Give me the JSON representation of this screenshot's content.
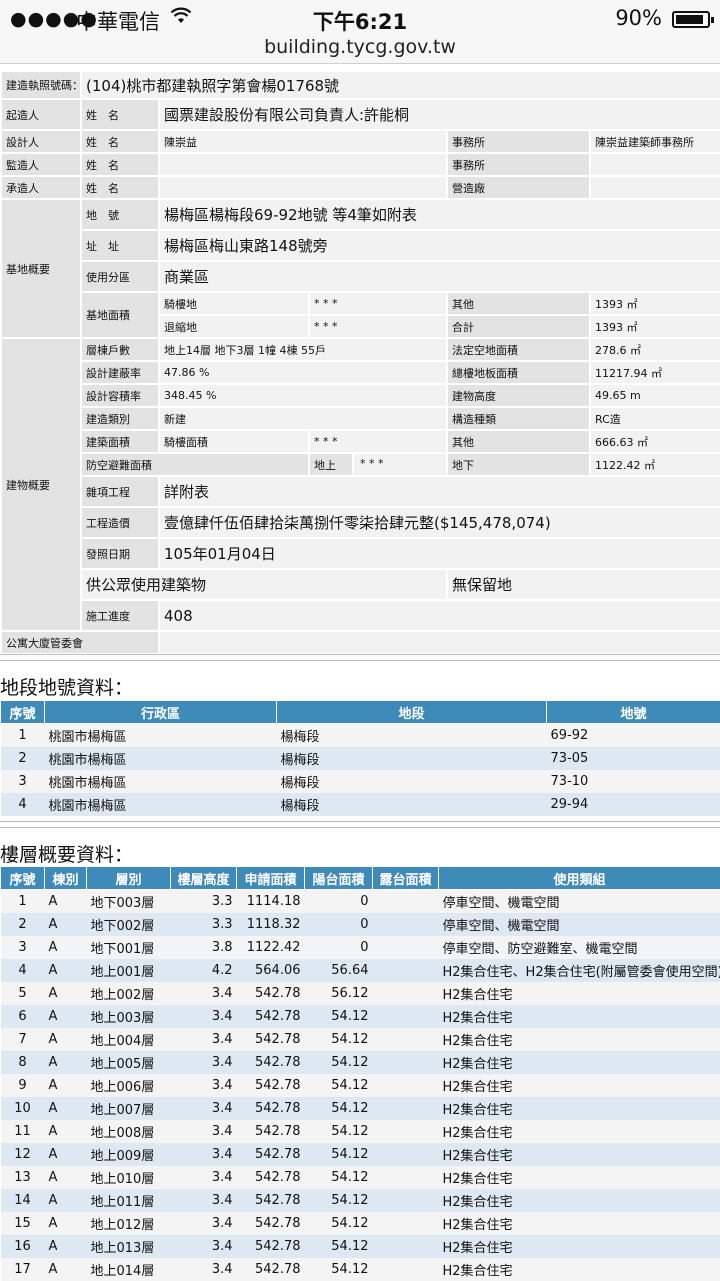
{
  "status_bar": {
    "signal": "●●●●●",
    "carrier": "中華電信",
    "time": "下午6:21",
    "battery": "90%",
    "battery_level": 0.9,
    "url": "building.tycg.gov.tw"
  },
  "permit": {
    "permit_no_label": "建造執照號碼：",
    "permit_no": "(104)桃市都建執照字第會楊01768號",
    "builder_label": "起造人",
    "name_label": "姓　名",
    "builder_name": "國票建設股份有限公司負責人:許能桐",
    "designer_label": "設計人",
    "designer_name": "陳崇益",
    "office_label": "事務所",
    "designer_office": "陳崇益建築師事務所",
    "supervisor_label": "監造人",
    "supervisor_name": "",
    "supervisor_office": "",
    "contractor_label": "承造人",
    "contractor_name": "",
    "factory_label": "營造廠",
    "contractor_factory": "",
    "site_label": "基地概要",
    "lot_label": "地　號",
    "lot_value": "楊梅區楊梅段69-92地號 等4筆如附表",
    "addr_label": "址　址",
    "addr_value": "楊梅區梅山東路148號旁",
    "zone_label": "使用分區",
    "zone_value": "商業區",
    "area_label": "基地面積",
    "arcade_label": "騎樓地",
    "arcade_value": "* * *",
    "other_label": "其他",
    "other_area": "1393 ㎡",
    "setback_label": "退縮地",
    "setback_value": "* * *",
    "total_label": "合計",
    "total_area": "1393 ㎡",
    "bldg_label": "建物概要",
    "floors_label": "層棟戶數",
    "floors_value": "地上14層 地下3層 1幢 4棟 55戶",
    "open_label": "法定空地面積",
    "open_value": "278.6 ㎡",
    "cover_label": "設計建蔽率",
    "cover_value": "47.86 %",
    "floorarea_label": "總樓地板面積",
    "floorarea_value": "11217.94 ㎡",
    "far_label": "設計容積率",
    "far_value": "348.45 %",
    "height_label": "建物高度",
    "height_value": "49.65 m",
    "type_label": "建造類別",
    "type_value": "新建",
    "struct_label": "構造種類",
    "struct_value": "RC造",
    "bldgarea_label": "建築面積",
    "arcade_area_label": "騎樓面積",
    "arcade_area_value": "* * *",
    "other2_label": "其他",
    "other2_value": "666.63 ㎡",
    "shelter_label": "防空避難面積",
    "above_label": "地上",
    "above_value": "* * *",
    "below_label": "地下",
    "below_value": "1122.42 ㎡",
    "misc_label": "雜項工程",
    "misc_value": "詳附表",
    "cost_label": "工程造價",
    "cost_value": "壹億肆仟伍佰肆拾柒萬捌仟零柒拾肆元整($145,478,074)",
    "issue_label": "發照日期",
    "issue_value": "105年01月04日",
    "public_use": "供公眾使用建築物",
    "no_reserve": "無保留地",
    "progress_label": "施工進度",
    "progress_value": "408",
    "committee_label": "公寓大廈管委會",
    "committee_value": ""
  },
  "land_section": {
    "title": "地段地號資料：",
    "headers": [
      "序號",
      "行政區",
      "地段",
      "地號"
    ],
    "rows": [
      [
        "1",
        "桃園市楊梅區",
        "楊梅段",
        "69-92"
      ],
      [
        "2",
        "桃園市楊梅區",
        "楊梅段",
        "73-05"
      ],
      [
        "3",
        "桃園市楊梅區",
        "楊梅段",
        "73-10"
      ],
      [
        "4",
        "桃園市楊梅區",
        "楊梅段",
        "29-94"
      ]
    ]
  },
  "floor_section": {
    "title": "樓層概要資料：",
    "headers": [
      "序號",
      "棟別",
      "層別",
      "樓層高度",
      "申請面積",
      "陽台面積",
      "露台面積",
      "使用類組"
    ],
    "rows": [
      [
        "1",
        "A",
        "地下003層",
        "3.3",
        "1114.18",
        "0",
        "",
        "停車空間、機電空間"
      ],
      [
        "2",
        "A",
        "地下002層",
        "3.3",
        "1118.32",
        "0",
        "",
        "停車空間、機電空間"
      ],
      [
        "3",
        "A",
        "地下001層",
        "3.8",
        "1122.42",
        "0",
        "",
        "停車空間、防空避難室、機電空間"
      ],
      [
        "4",
        "A",
        "地上001層",
        "4.2",
        "564.06",
        "56.64",
        "",
        "H2集合住宅、H2集合住宅(附屬管委會使用空間)"
      ],
      [
        "5",
        "A",
        "地上002層",
        "3.4",
        "542.78",
        "56.12",
        "",
        "H2集合住宅"
      ],
      [
        "6",
        "A",
        "地上003層",
        "3.4",
        "542.78",
        "54.12",
        "",
        "H2集合住宅"
      ],
      [
        "7",
        "A",
        "地上004層",
        "3.4",
        "542.78",
        "54.12",
        "",
        "H2集合住宅"
      ],
      [
        "8",
        "A",
        "地上005層",
        "3.4",
        "542.78",
        "54.12",
        "",
        "H2集合住宅"
      ],
      [
        "9",
        "A",
        "地上006層",
        "3.4",
        "542.78",
        "54.12",
        "",
        "H2集合住宅"
      ],
      [
        "10",
        "A",
        "地上007層",
        "3.4",
        "542.78",
        "54.12",
        "",
        "H2集合住宅"
      ],
      [
        "11",
        "A",
        "地上008層",
        "3.4",
        "542.78",
        "54.12",
        "",
        "H2集合住宅"
      ],
      [
        "12",
        "A",
        "地上009層",
        "3.4",
        "542.78",
        "54.12",
        "",
        "H2集合住宅"
      ],
      [
        "13",
        "A",
        "地上010層",
        "3.4",
        "542.78",
        "54.12",
        "",
        "H2集合住宅"
      ],
      [
        "14",
        "A",
        "地上011層",
        "3.4",
        "542.78",
        "54.12",
        "",
        "H2集合住宅"
      ],
      [
        "15",
        "A",
        "地上012層",
        "3.4",
        "542.78",
        "54.12",
        "",
        "H2集合住宅"
      ],
      [
        "16",
        "A",
        "地上013層",
        "3.4",
        "542.78",
        "54.12",
        "",
        "H2集合住宅"
      ],
      [
        "17",
        "A",
        "地上014層",
        "3.4",
        "542.78",
        "54.12",
        "",
        "H2集合住宅"
      ]
    ]
  }
}
